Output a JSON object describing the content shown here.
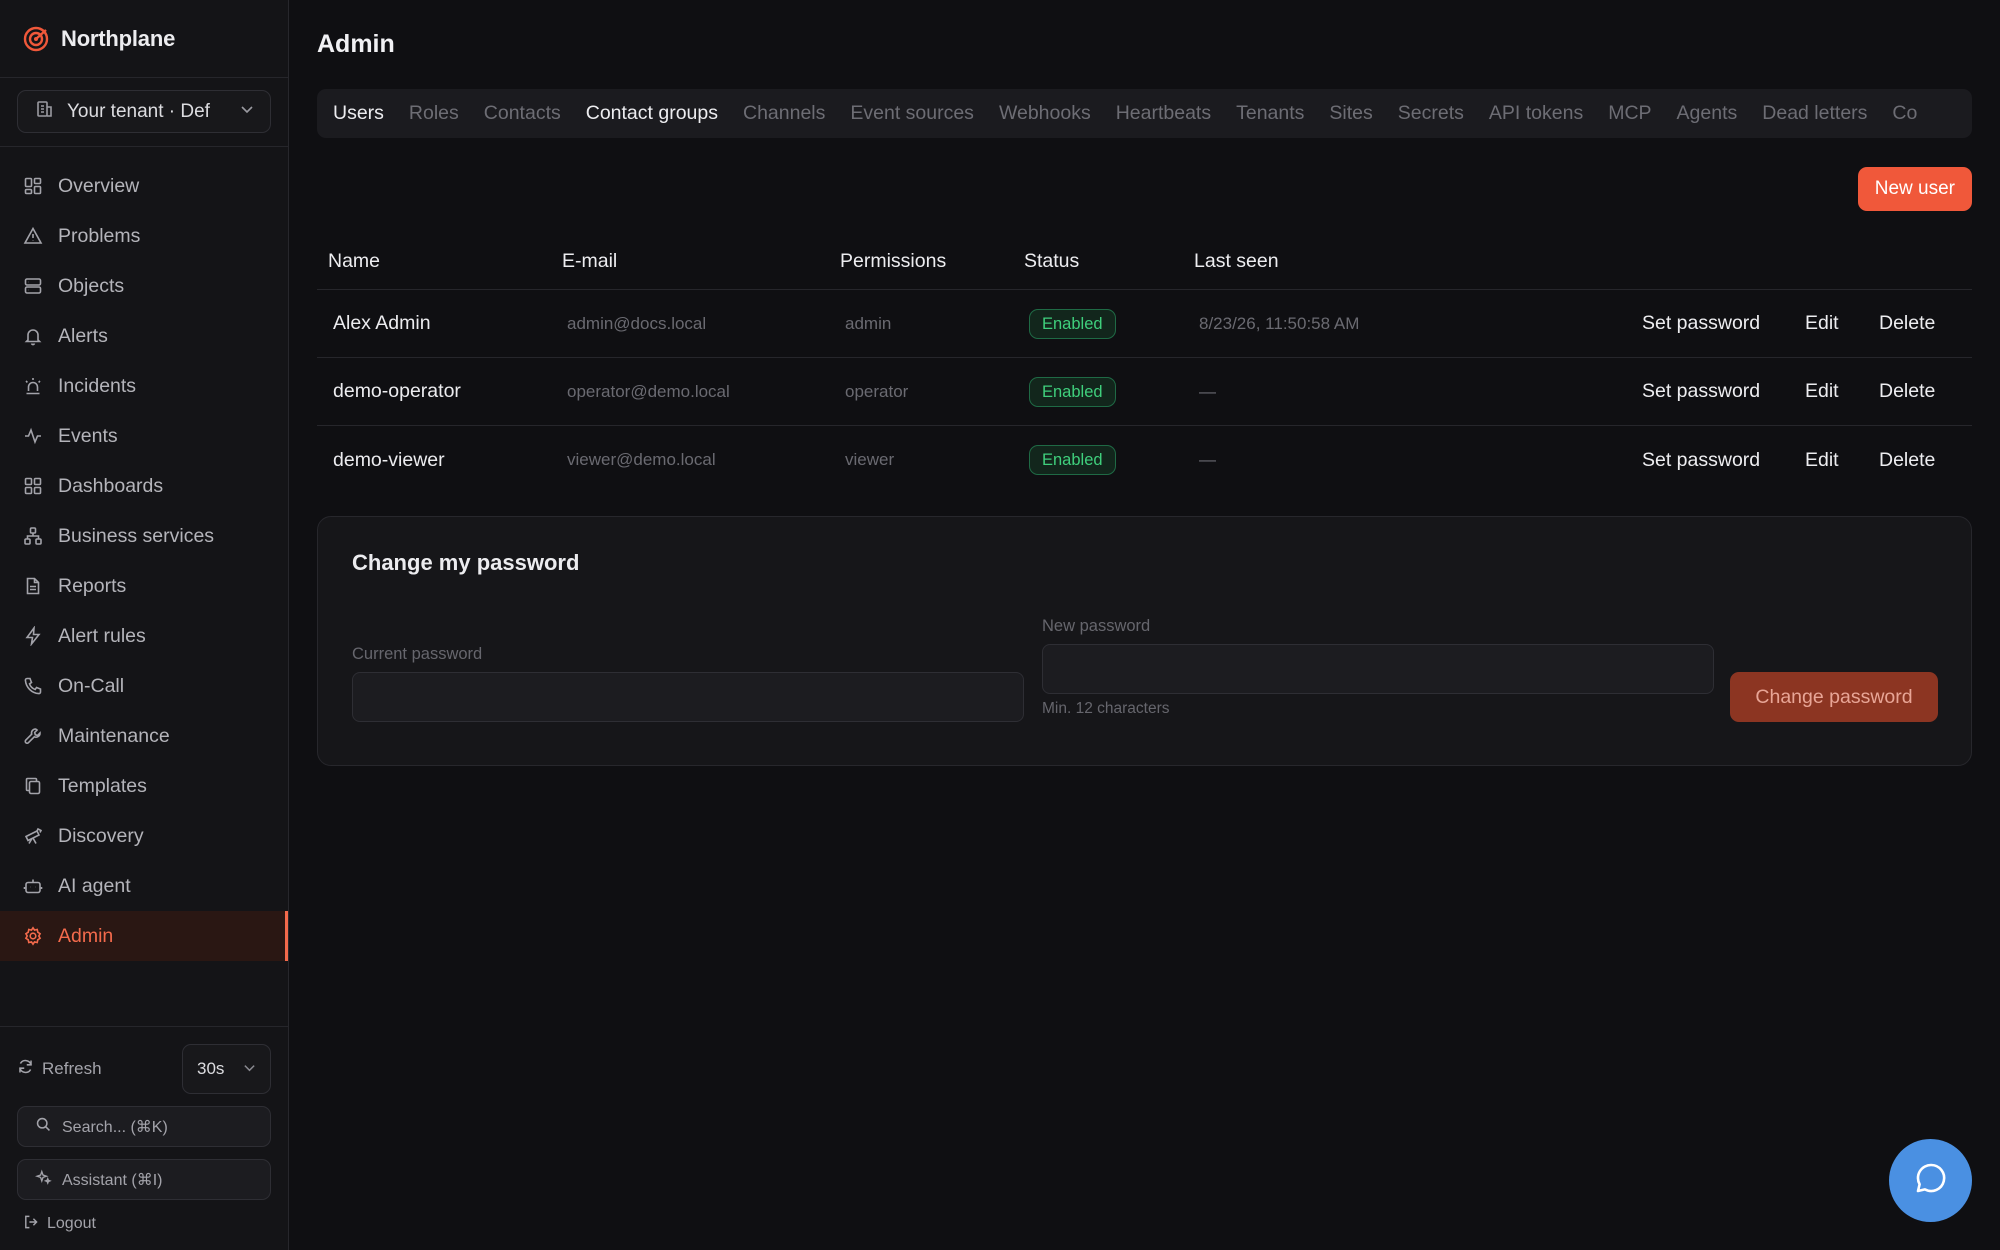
{
  "brand": {
    "name": "Northplane",
    "accent": "#f0583a"
  },
  "tenant": {
    "label": "Your tenant · Def"
  },
  "sidebar": {
    "items": [
      {
        "label": "Overview",
        "icon": "grid-icon"
      },
      {
        "label": "Problems",
        "icon": "warning-icon"
      },
      {
        "label": "Objects",
        "icon": "server-icon"
      },
      {
        "label": "Alerts",
        "icon": "bell-icon"
      },
      {
        "label": "Incidents",
        "icon": "siren-icon"
      },
      {
        "label": "Events",
        "icon": "activity-icon"
      },
      {
        "label": "Dashboards",
        "icon": "dashboard-icon"
      },
      {
        "label": "Business services",
        "icon": "network-icon"
      },
      {
        "label": "Reports",
        "icon": "file-icon"
      },
      {
        "label": "Alert rules",
        "icon": "lightning-icon"
      },
      {
        "label": "On-Call",
        "icon": "phone-icon"
      },
      {
        "label": "Maintenance",
        "icon": "wrench-icon"
      },
      {
        "label": "Templates",
        "icon": "copy-icon"
      },
      {
        "label": "Discovery",
        "icon": "telescope-icon"
      },
      {
        "label": "AI agent",
        "icon": "bot-icon"
      },
      {
        "label": "Admin",
        "icon": "gear-icon",
        "active": true
      }
    ],
    "refresh_label": "Refresh",
    "refresh_interval": "30s",
    "search_label": "Search... (⌘K)",
    "assistant_label": "Assistant (⌘I)",
    "logout_label": "Logout"
  },
  "page": {
    "title": "Admin"
  },
  "tabs": [
    {
      "label": "Users",
      "bright": true
    },
    {
      "label": "Roles"
    },
    {
      "label": "Contacts"
    },
    {
      "label": "Contact groups",
      "bright": true
    },
    {
      "label": "Channels"
    },
    {
      "label": "Event sources"
    },
    {
      "label": "Webhooks"
    },
    {
      "label": "Heartbeats"
    },
    {
      "label": "Tenants"
    },
    {
      "label": "Sites"
    },
    {
      "label": "Secrets"
    },
    {
      "label": "API tokens"
    },
    {
      "label": "MCP"
    },
    {
      "label": "Agents"
    },
    {
      "label": "Dead letters"
    },
    {
      "label": "Co"
    }
  ],
  "new_user_label": "New user",
  "table": {
    "headers": [
      "Name",
      "E-mail",
      "Permissions",
      "Status",
      "Last seen"
    ],
    "rows": [
      {
        "name": "Alex Admin",
        "email": "admin@docs.local",
        "permissions": "admin",
        "status": "Enabled",
        "last_seen": "8/23/26, 11:50:58 AM"
      },
      {
        "name": "demo-operator",
        "email": "operator@demo.local",
        "permissions": "operator",
        "status": "Enabled",
        "last_seen": "—"
      },
      {
        "name": "demo-viewer",
        "email": "viewer@demo.local",
        "permissions": "viewer",
        "status": "Enabled",
        "last_seen": "—"
      }
    ],
    "actions": {
      "set_password": "Set password",
      "edit": "Edit",
      "delete": "Delete"
    }
  },
  "password_card": {
    "title": "Change my password",
    "current_label": "Current password",
    "current_value": "",
    "new_label": "New password",
    "new_value": "",
    "new_hint": "Min. 12 characters",
    "submit_label": "Change password"
  },
  "colors": {
    "status_enabled": "#3fcf7c",
    "chat_button": "#4a90e2"
  }
}
